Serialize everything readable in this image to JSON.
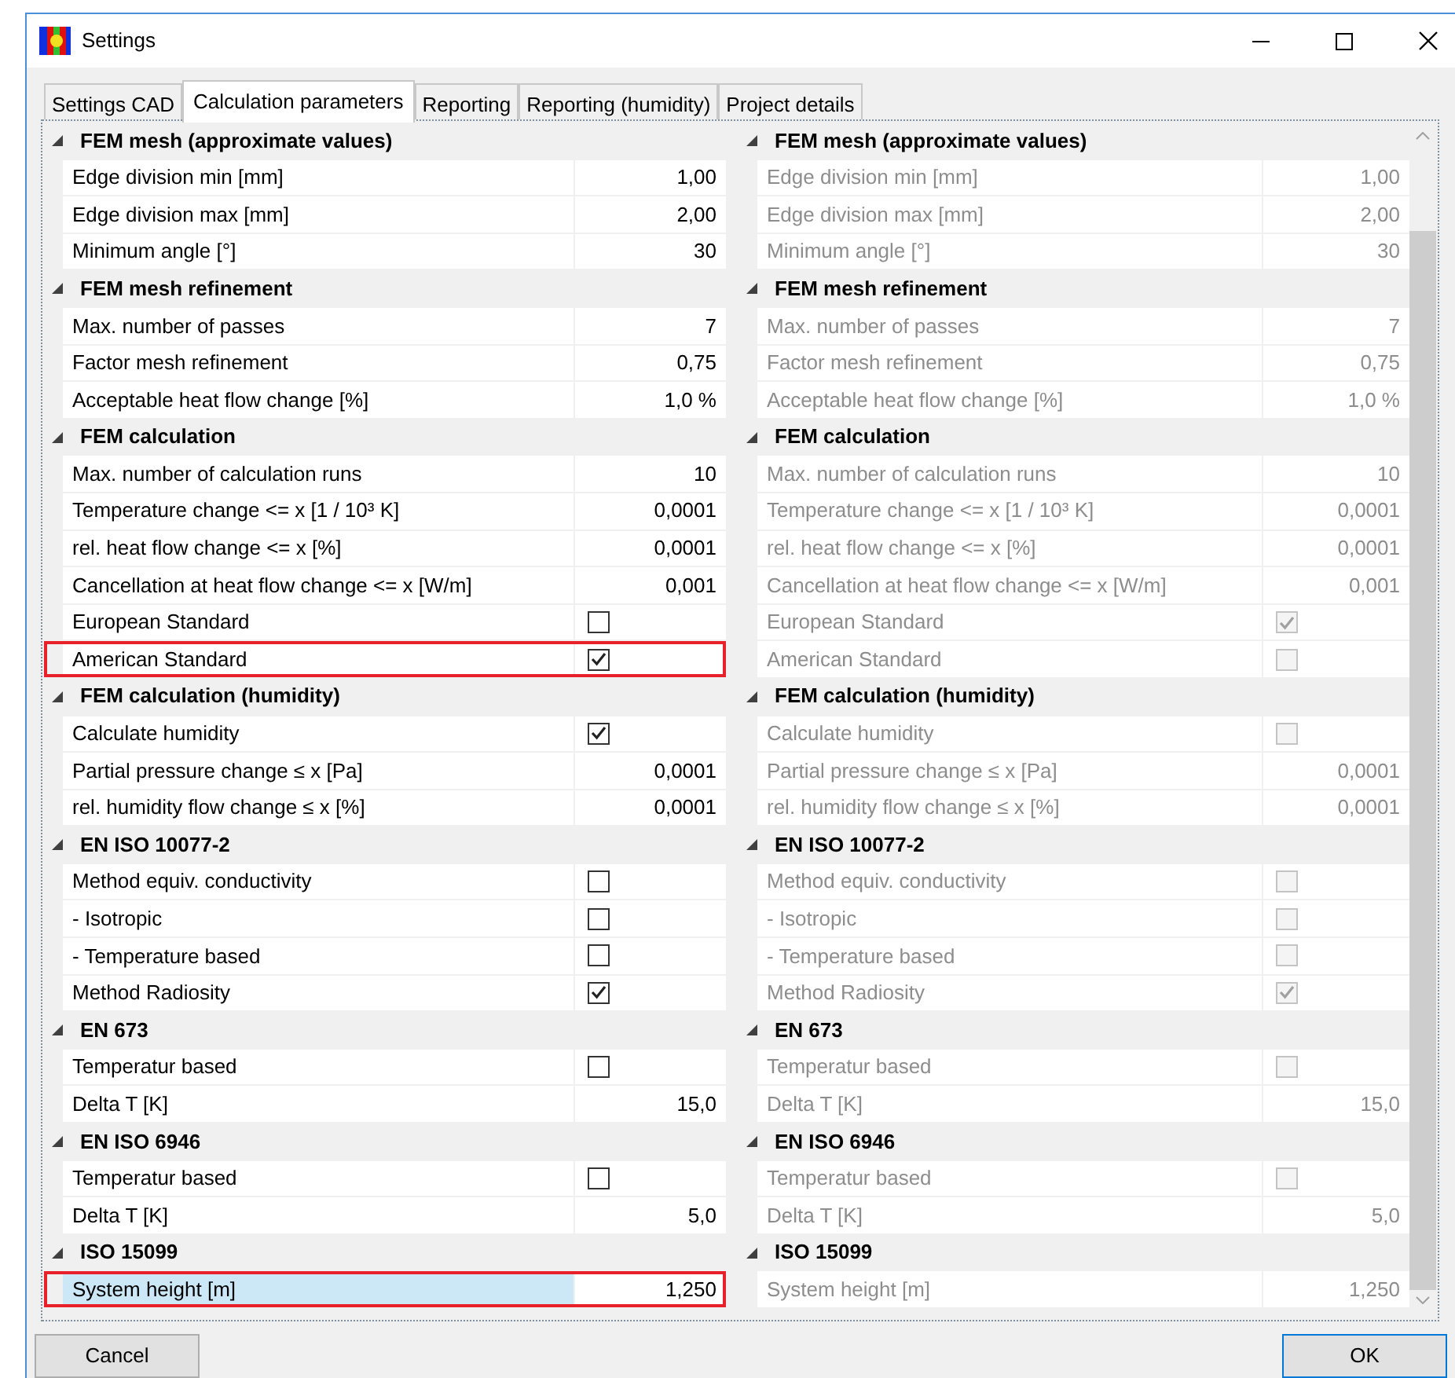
{
  "window": {
    "title": "Settings"
  },
  "tabs": [
    {
      "label": "Settings CAD",
      "selected": false
    },
    {
      "label": "Calculation parameters",
      "selected": true
    },
    {
      "label": "Reporting",
      "selected": false
    },
    {
      "label": "Reporting (humidity)",
      "selected": false
    },
    {
      "label": "Project details",
      "selected": false
    }
  ],
  "panels": [
    {
      "disabled": false,
      "sections": [
        {
          "title": "FEM mesh (approximate values)",
          "expanded": true,
          "items": [
            {
              "kind": "value",
              "label": "Edge division min [mm]",
              "value": "1,00",
              "selected": false,
              "highlighted": false
            },
            {
              "kind": "value",
              "label": "Edge division max [mm]",
              "value": "2,00",
              "selected": false,
              "highlighted": false
            },
            {
              "kind": "value",
              "label": "Minimum angle [°]",
              "value": "30",
              "selected": false,
              "highlighted": false
            }
          ]
        },
        {
          "title": "FEM mesh refinement",
          "expanded": true,
          "items": [
            {
              "kind": "value",
              "label": "Max. number of passes",
              "value": "7",
              "selected": false,
              "highlighted": false
            },
            {
              "kind": "value",
              "label": "Factor mesh refinement",
              "value": "0,75",
              "selected": false,
              "highlighted": false
            },
            {
              "kind": "value",
              "label": "Acceptable heat flow change [%]",
              "value": "1,0 %",
              "selected": false,
              "highlighted": false
            }
          ]
        },
        {
          "title": "FEM calculation",
          "expanded": true,
          "items": [
            {
              "kind": "value",
              "label": "Max. number of calculation runs",
              "value": "10",
              "selected": false,
              "highlighted": false
            },
            {
              "kind": "value",
              "label": "Temperature change <= x [1 / 10³ K]",
              "value": "0,0001",
              "selected": false,
              "highlighted": false
            },
            {
              "kind": "value",
              "label": "rel. heat flow change <= x [%]",
              "value": "0,0001",
              "selected": false,
              "highlighted": false
            },
            {
              "kind": "value",
              "label": "Cancellation at heat flow change <= x [W/m]",
              "value": "0,001",
              "selected": false,
              "highlighted": false
            },
            {
              "kind": "checkbox",
              "label": "European Standard",
              "checked": false,
              "selected": false,
              "highlighted": false
            },
            {
              "kind": "checkbox",
              "label": "American Standard",
              "checked": true,
              "selected": false,
              "highlighted": true
            }
          ]
        },
        {
          "title": "FEM calculation (humidity)",
          "expanded": true,
          "items": [
            {
              "kind": "checkbox",
              "label": "Calculate humidity",
              "checked": true,
              "selected": false,
              "highlighted": false
            },
            {
              "kind": "value",
              "label": "Partial pressure change ≤ x [Pa]",
              "value": "0,0001",
              "selected": false,
              "highlighted": false
            },
            {
              "kind": "value",
              "label": "rel. humidity flow change ≤ x [%]",
              "value": "0,0001",
              "selected": false,
              "highlighted": false
            }
          ]
        },
        {
          "title": "EN ISO 10077-2",
          "expanded": true,
          "items": [
            {
              "kind": "checkbox",
              "label": "Method equiv. conductivity",
              "checked": false,
              "selected": false,
              "highlighted": false
            },
            {
              "kind": "checkbox",
              "label": "- Isotropic",
              "checked": false,
              "selected": false,
              "highlighted": false
            },
            {
              "kind": "checkbox",
              "label": "- Temperature based",
              "checked": false,
              "selected": false,
              "highlighted": false
            },
            {
              "kind": "checkbox",
              "label": "Method Radiosity",
              "checked": true,
              "selected": false,
              "highlighted": false
            }
          ]
        },
        {
          "title": "EN 673",
          "expanded": true,
          "items": [
            {
              "kind": "checkbox",
              "label": "Temperatur based",
              "checked": false,
              "selected": false,
              "highlighted": false
            },
            {
              "kind": "value",
              "label": "Delta T [K]",
              "value": "15,0",
              "selected": false,
              "highlighted": false
            }
          ]
        },
        {
          "title": "EN ISO 6946",
          "expanded": true,
          "items": [
            {
              "kind": "checkbox",
              "label": "Temperatur based",
              "checked": false,
              "selected": false,
              "highlighted": false
            },
            {
              "kind": "value",
              "label": "Delta T [K]",
              "value": "5,0",
              "selected": false,
              "highlighted": false
            }
          ]
        },
        {
          "title": "ISO 15099",
          "expanded": true,
          "items": [
            {
              "kind": "value",
              "label": "System height [m]",
              "value": "1,250",
              "selected": true,
              "highlighted": true
            }
          ]
        }
      ]
    },
    {
      "disabled": true,
      "sections": [
        {
          "title": "FEM mesh (approximate values)",
          "expanded": true,
          "items": [
            {
              "kind": "value",
              "label": "Edge division min [mm]",
              "value": "1,00",
              "selected": false,
              "highlighted": false
            },
            {
              "kind": "value",
              "label": "Edge division max [mm]",
              "value": "2,00",
              "selected": false,
              "highlighted": false
            },
            {
              "kind": "value",
              "label": "Minimum angle [°]",
              "value": "30",
              "selected": false,
              "highlighted": false
            }
          ]
        },
        {
          "title": "FEM mesh refinement",
          "expanded": true,
          "items": [
            {
              "kind": "value",
              "label": "Max. number of passes",
              "value": "7",
              "selected": false,
              "highlighted": false
            },
            {
              "kind": "value",
              "label": "Factor mesh refinement",
              "value": "0,75",
              "selected": false,
              "highlighted": false
            },
            {
              "kind": "value",
              "label": "Acceptable heat flow change [%]",
              "value": "1,0 %",
              "selected": false,
              "highlighted": false
            }
          ]
        },
        {
          "title": "FEM calculation",
          "expanded": true,
          "items": [
            {
              "kind": "value",
              "label": "Max. number of calculation runs",
              "value": "10",
              "selected": false,
              "highlighted": false
            },
            {
              "kind": "value",
              "label": "Temperature change <= x [1 / 10³ K]",
              "value": "0,0001",
              "selected": false,
              "highlighted": false
            },
            {
              "kind": "value",
              "label": "rel. heat flow change <= x [%]",
              "value": "0,0001",
              "selected": false,
              "highlighted": false
            },
            {
              "kind": "value",
              "label": "Cancellation at heat flow change <= x [W/m]",
              "value": "0,001",
              "selected": false,
              "highlighted": false
            },
            {
              "kind": "checkbox",
              "label": "European Standard",
              "checked": true,
              "selected": false,
              "highlighted": false
            },
            {
              "kind": "checkbox",
              "label": "American Standard",
              "checked": false,
              "selected": false,
              "highlighted": false
            }
          ]
        },
        {
          "title": "FEM calculation (humidity)",
          "expanded": true,
          "items": [
            {
              "kind": "checkbox",
              "label": "Calculate humidity",
              "checked": false,
              "selected": false,
              "highlighted": false
            },
            {
              "kind": "value",
              "label": "Partial pressure change ≤ x [Pa]",
              "value": "0,0001",
              "selected": false,
              "highlighted": false
            },
            {
              "kind": "value",
              "label": "rel. humidity flow change ≤ x [%]",
              "value": "0,0001",
              "selected": false,
              "highlighted": false
            }
          ]
        },
        {
          "title": "EN ISO 10077-2",
          "expanded": true,
          "items": [
            {
              "kind": "checkbox",
              "label": "Method equiv. conductivity",
              "checked": false,
              "selected": false,
              "highlighted": false
            },
            {
              "kind": "checkbox",
              "label": "- Isotropic",
              "checked": false,
              "selected": false,
              "highlighted": false
            },
            {
              "kind": "checkbox",
              "label": "- Temperature based",
              "checked": false,
              "selected": false,
              "highlighted": false
            },
            {
              "kind": "checkbox",
              "label": "Method Radiosity",
              "checked": true,
              "selected": false,
              "highlighted": false
            }
          ]
        },
        {
          "title": "EN 673",
          "expanded": true,
          "items": [
            {
              "kind": "checkbox",
              "label": "Temperatur based",
              "checked": false,
              "selected": false,
              "highlighted": false
            },
            {
              "kind": "value",
              "label": "Delta T [K]",
              "value": "15,0",
              "selected": false,
              "highlighted": false
            }
          ]
        },
        {
          "title": "EN ISO 6946",
          "expanded": true,
          "items": [
            {
              "kind": "checkbox",
              "label": "Temperatur based",
              "checked": false,
              "selected": false,
              "highlighted": false
            },
            {
              "kind": "value",
              "label": "Delta T [K]",
              "value": "5,0",
              "selected": false,
              "highlighted": false
            }
          ]
        },
        {
          "title": "ISO 15099",
          "expanded": true,
          "items": [
            {
              "kind": "value",
              "label": "System height [m]",
              "value": "1,250",
              "selected": false,
              "highlighted": false
            }
          ]
        }
      ]
    }
  ],
  "buttons": [
    {
      "label": "Cancel",
      "default": false
    },
    {
      "label": "OK",
      "default": true
    }
  ]
}
